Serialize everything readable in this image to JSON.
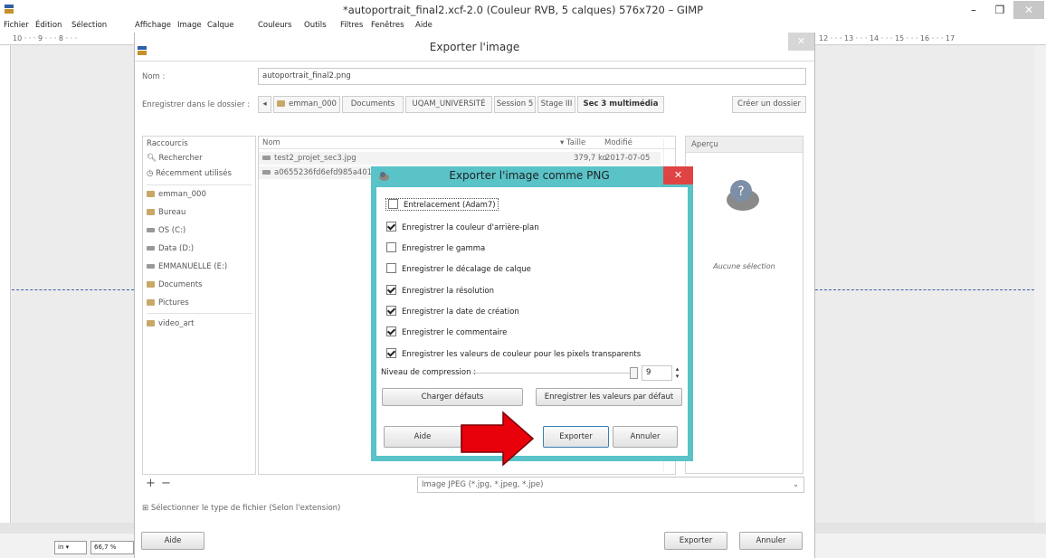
{
  "window": {
    "title": "*autoportrait_final2.xcf-2.0 (Couleur RVB, 5 calques) 576x720 – GIMP",
    "minimize": "–",
    "maximize": "❐",
    "close": "✕"
  },
  "menubar": [
    "Fichier",
    "Édition",
    "Sélection",
    "Affichage",
    "Image",
    "Calque",
    "Couleurs",
    "Outils",
    "Filtres",
    "Fenêtres",
    "Aide"
  ],
  "rulers": {
    "left_top": "10 · · · 9 · · · 8 · · ·",
    "right_top": "12 · · · 13 · · · 14 · · · 15 · · · 16 · · · 17"
  },
  "status": {
    "unit": "in",
    "zoom": "66,7 %"
  },
  "export_dialog": {
    "title": "Exporter l'image",
    "close": "✕",
    "name_label": "Nom :",
    "name_value": "autoportrait_final2.png",
    "folder_label": "Enregistrer dans le dossier :",
    "back_arrow": "◂",
    "breadcrumbs": [
      "emman_000",
      "Documents",
      "UQAM_UNIVERSITÉ",
      "Session 5",
      "Stage III",
      "Sec 3 multimédia"
    ],
    "create_folder": "Créer un dossier",
    "places_header": "Raccourcis",
    "places": [
      {
        "label": "Rechercher",
        "icon": "search-icon"
      },
      {
        "label": "Récemment utilisés",
        "icon": "clock-icon"
      },
      {
        "label": "emman_000",
        "icon": "folder-icon"
      },
      {
        "label": "Bureau",
        "icon": "folder-icon"
      },
      {
        "label": "OS (C:)",
        "icon": "drive-icon"
      },
      {
        "label": "Data (D:)",
        "icon": "drive-icon"
      },
      {
        "label": "EMMANUELLE (E:)",
        "icon": "drive-icon"
      },
      {
        "label": "Documents",
        "icon": "folder-icon"
      },
      {
        "label": "Pictures",
        "icon": "folder-icon"
      },
      {
        "label": "video_art",
        "icon": "folder-icon"
      }
    ],
    "columns": {
      "name": "Nom",
      "size": "Taille",
      "modified": "Modifié"
    },
    "files": [
      {
        "name": "test2_projet_sec3.jpg",
        "size": "379,7 ko",
        "modified": "2017-07-05"
      },
      {
        "name": "a0655236fd6efd985a401c",
        "size": "",
        "modified": ""
      }
    ],
    "preview_header": "Aperçu",
    "preview_text": "Aucune sélection",
    "add": "+",
    "remove": "−",
    "filetype": "Image JPEG (*.jpg, *.jpeg, *.jpe)",
    "select_type": "Sélectionner le type de fichier (Selon l'extension)",
    "help": "Aide",
    "export": "Exporter",
    "cancel": "Annuler"
  },
  "png_dialog": {
    "title": "Exporter l'image comme PNG",
    "close": "✕",
    "options": [
      {
        "label": "Entrelacement (Adam7)",
        "checked": false
      },
      {
        "label": "Enregistrer la couleur d'arrière-plan",
        "checked": true
      },
      {
        "label": "Enregistrer le gamma",
        "checked": false
      },
      {
        "label": "Enregistrer le décalage de calque",
        "checked": false
      },
      {
        "label": "Enregistrer la résolution",
        "checked": true
      },
      {
        "label": "Enregistrer la date de création",
        "checked": true
      },
      {
        "label": "Enregistrer le commentaire",
        "checked": true
      },
      {
        "label": "Enregistrer les valeurs de couleur pour les pixels transparents",
        "checked": true
      }
    ],
    "compression_label": "Niveau de compression :",
    "compression_value": "9",
    "load_defaults": "Charger défauts",
    "save_defaults": "Enregistrer les valeurs par défaut",
    "help": "Aide",
    "export": "Exporter",
    "cancel": "Annuler"
  },
  "annotation_color": "#e8000a"
}
